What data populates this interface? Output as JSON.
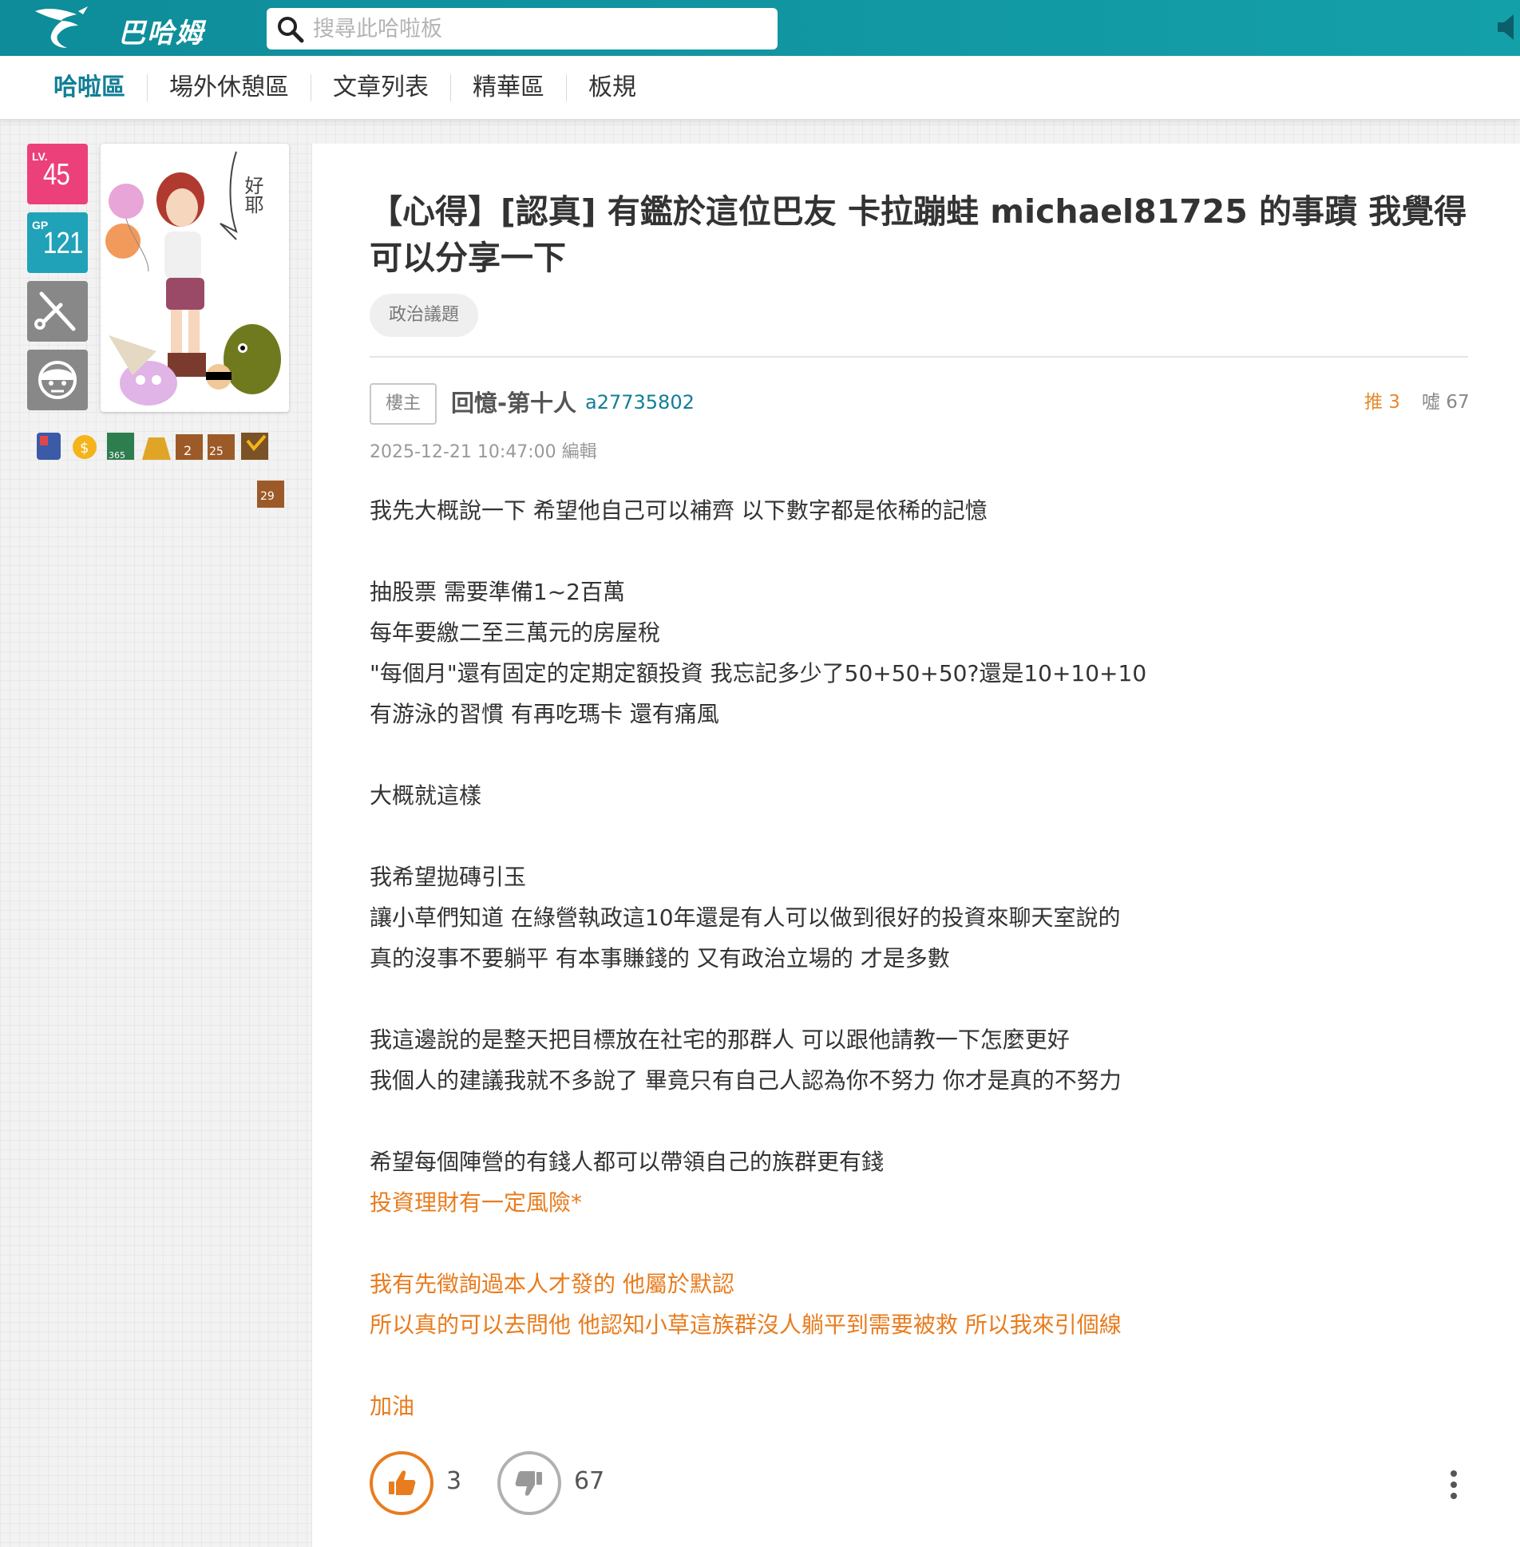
{
  "header": {
    "logo_text": "巴哈姆特",
    "search_placeholder": "搜尋此哈啦板"
  },
  "nav": {
    "items": [
      {
        "label": "哈啦區",
        "active": true
      },
      {
        "label": "場外休憩區",
        "active": false
      },
      {
        "label": "文章列表",
        "active": false
      },
      {
        "label": "精華區",
        "active": false
      },
      {
        "label": "板規",
        "active": false
      }
    ]
  },
  "user": {
    "lv_tag": "LV.",
    "lv": "45",
    "gp_tag": "GP",
    "gp": "121",
    "avatar_bubble": "好耶",
    "badge_icons": [
      "knight-badge-icon",
      "coin-badge-icon",
      "365-badge-icon",
      "gold-badge-icon",
      "2-badge-icon",
      "25-badge-icon",
      "1000-badge-icon",
      "29-badge-icon"
    ]
  },
  "post": {
    "title": "【心得】[認真] 有鑑於這位巴友 卡拉蹦蛙 michael81725 的事蹟 我覺得可以分享一下",
    "tag": "政治議題",
    "floor_label": "樓主",
    "author_name": "回憶-第十人",
    "author_id": "a27735802",
    "gp_label": "推 3",
    "bp_label": "噓 67",
    "time": "2025-12-21 10:47:00 編輯",
    "lines": [
      {
        "text": "我先大概說一下 希望他自己可以補齊 以下數字都是依稀的記憶",
        "color": "normal"
      },
      {
        "text": "",
        "color": "normal"
      },
      {
        "text": "抽股票 需要準備1~2百萬",
        "color": "normal"
      },
      {
        "text": "每年要繳二至三萬元的房屋稅",
        "color": "normal"
      },
      {
        "text": "\"每個月\"還有固定的定期定額投資 我忘記多少了50+50+50?還是10+10+10",
        "color": "normal"
      },
      {
        "text": "有游泳的習慣 有再吃瑪卡 還有痛風",
        "color": "normal"
      },
      {
        "text": "",
        "color": "normal"
      },
      {
        "text": "大概就這樣",
        "color": "normal"
      },
      {
        "text": "",
        "color": "normal"
      },
      {
        "text": "我希望拋磚引玉",
        "color": "normal"
      },
      {
        "text": "讓小草們知道 在綠營執政這10年還是有人可以做到很好的投資來聊天室說的",
        "color": "normal"
      },
      {
        "text": "真的沒事不要躺平 有本事賺錢的 又有政治立場的 才是多數",
        "color": "normal"
      },
      {
        "text": "",
        "color": "normal"
      },
      {
        "text": "我這邊說的是整天把目標放在社宅的那群人 可以跟他請教一下怎麼更好",
        "color": "normal"
      },
      {
        "text": "我個人的建議我就不多說了 畢竟只有自己人認為你不努力 你才是真的不努力",
        "color": "normal"
      },
      {
        "text": "",
        "color": "normal"
      },
      {
        "text": "希望每個陣營的有錢人都可以帶領自己的族群更有錢",
        "color": "normal"
      },
      {
        "text": "投資理財有一定風險*",
        "color": "orange"
      },
      {
        "text": "",
        "color": "normal"
      },
      {
        "text": "我有先徵詢過本人才發的 他屬於默認",
        "color": "orange"
      },
      {
        "text": "所以真的可以去問他 他認知小草這族群沒人躺平到需要被救 所以我來引個線",
        "color": "orange"
      },
      {
        "text": "",
        "color": "normal"
      },
      {
        "text": "加油",
        "color": "orange"
      }
    ],
    "gp_count": "3",
    "bp_count": "67"
  },
  "colors": {
    "header_bg": "#0e8c99",
    "accent": "#117e96",
    "orange": "#e87c1e",
    "lv_pink": "#ec407a",
    "gp_teal": "#20a2b8"
  }
}
